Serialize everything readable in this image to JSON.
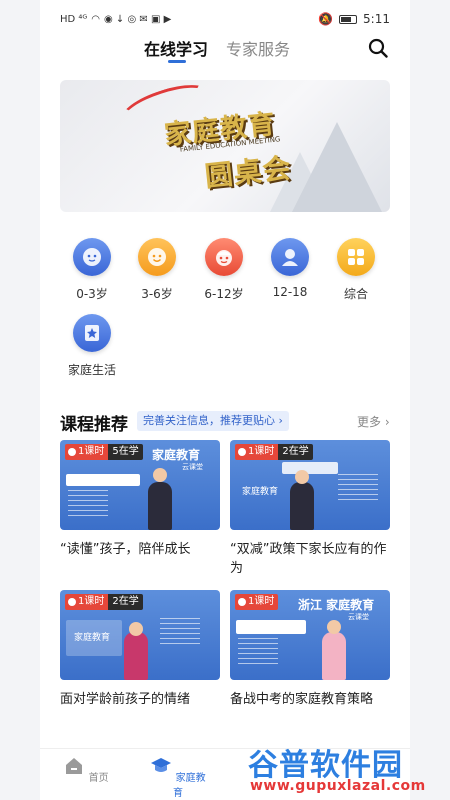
{
  "status_bar": {
    "left_text": "HD ⁴ᴳ",
    "time": "5:11"
  },
  "tabs": {
    "active": "在线学习",
    "inactive": "专家服务"
  },
  "banner": {
    "title_line1": "家庭教育",
    "subtitle": "FAMILY EDUCATION MEETING",
    "title_line2": "圆桌会"
  },
  "categories": [
    {
      "label": "0-3岁",
      "icon": "baby-face-icon",
      "color": "#4a78e0"
    },
    {
      "label": "3-6岁",
      "icon": "child-face-icon",
      "color": "#f5a623"
    },
    {
      "label": "6-12岁",
      "icon": "kid-face-icon",
      "color": "#ee5a43"
    },
    {
      "label": "12-18",
      "icon": "teen-person-icon",
      "color": "#4a78e0"
    },
    {
      "label": "综合",
      "icon": "grid-icon",
      "color": "#f3b22a"
    },
    {
      "label": "家庭生活",
      "icon": "star-book-icon",
      "color": "#4a78e0"
    }
  ],
  "section": {
    "title": "课程推荐",
    "tag": "完善关注信息，推荐更贴心 ›",
    "more": "更多 ›"
  },
  "courses": [
    {
      "lessons": "1课时",
      "learners": "5在学",
      "title": "“读懂”孩子，陪伴成长",
      "thumb_brand": "家庭教育",
      "thumb_sub": "云课堂"
    },
    {
      "lessons": "1课时",
      "learners": "2在学",
      "title": "“双减”政策下家长应有的作为",
      "thumb_brand": "家庭教育",
      "thumb_sub": "云课堂"
    },
    {
      "lessons": "1课时",
      "learners": "2在学",
      "title": "面对学龄前孩子的情绪",
      "thumb_brand": "家庭教育",
      "thumb_sub": "云课堂"
    },
    {
      "lessons": "1课时",
      "learners": "",
      "title": "备战中考的家庭教育策略",
      "thumb_brand": "浙江 家庭教育",
      "thumb_sub": "云课堂"
    }
  ],
  "nav": {
    "home": "首页",
    "family_edu": "家庭教育"
  },
  "watermark": {
    "title": "谷普软件园",
    "url": "www.gupuxlazal.com"
  },
  "colors": {
    "accent": "#2f6fd8",
    "badge_red": "#e5473a"
  }
}
